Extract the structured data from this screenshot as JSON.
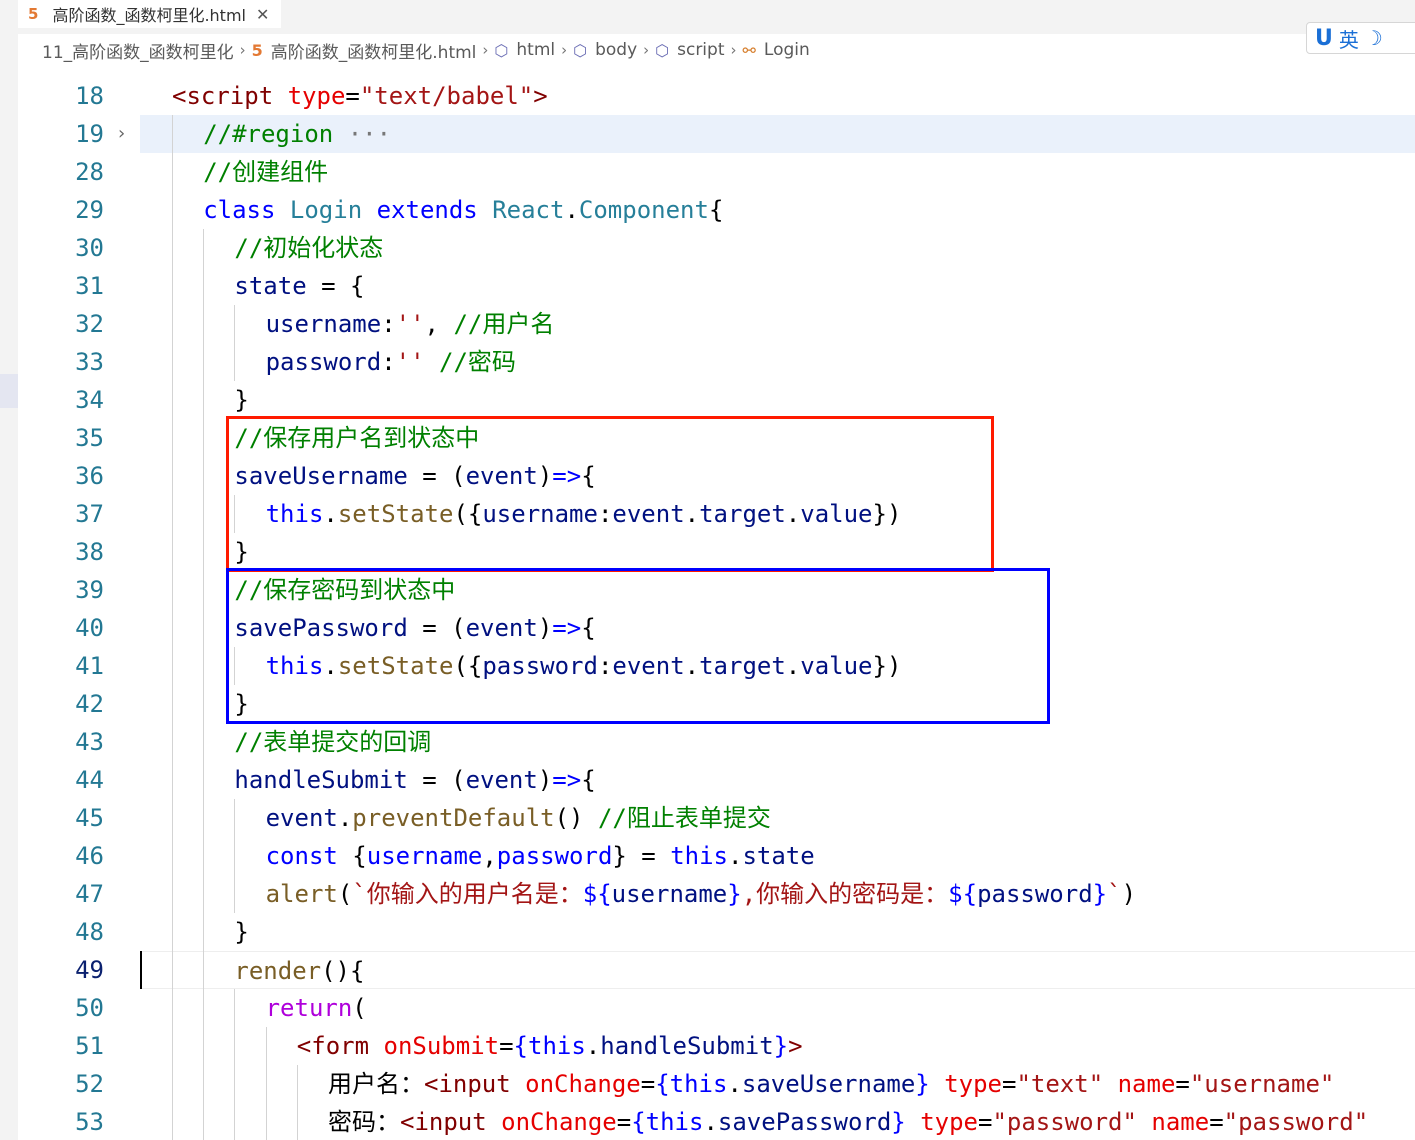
{
  "tab": {
    "title": "高阶函数_函数柯里化.html",
    "icon": "html5-icon"
  },
  "breadcrumb": [
    {
      "label": "11_高阶函数_函数柯里化",
      "icon": ""
    },
    {
      "label": "高阶函数_函数柯里化.html",
      "icon": "html5-icon"
    },
    {
      "label": "html",
      "icon": "cube-icon"
    },
    {
      "label": "body",
      "icon": "cube-icon"
    },
    {
      "label": "script",
      "icon": "cube-icon"
    },
    {
      "label": "Login",
      "icon": "class-icon"
    }
  ],
  "ime": {
    "logo": "U",
    "lang": "英",
    "mode": "☽"
  },
  "editor": {
    "current_line": 49,
    "folded_line": 19,
    "highlighted_line": 19,
    "lines": [
      {
        "n": 18,
        "indent": 1,
        "tokens": [
          [
            "tag",
            "<script "
          ],
          [
            "attr",
            "type"
          ],
          [
            "op",
            "="
          ],
          [
            "str",
            "\"text/babel\""
          ],
          [
            "tag",
            ">"
          ]
        ]
      },
      {
        "n": 19,
        "indent": 2,
        "tokens": [
          [
            "com",
            "//#region "
          ],
          [
            "dim",
            "···"
          ]
        ]
      },
      {
        "n": 28,
        "indent": 2,
        "tokens": [
          [
            "com",
            "//创建组件"
          ]
        ]
      },
      {
        "n": 29,
        "indent": 2,
        "tokens": [
          [
            "kw",
            "class "
          ],
          [
            "cls",
            "Login "
          ],
          [
            "kw",
            "extends "
          ],
          [
            "cls",
            "React"
          ],
          [
            "op",
            "."
          ],
          [
            "cls",
            "Component"
          ],
          [
            "op",
            "{"
          ]
        ]
      },
      {
        "n": 30,
        "indent": 3,
        "tokens": [
          [
            "com",
            "//初始化状态"
          ]
        ]
      },
      {
        "n": 31,
        "indent": 3,
        "tokens": [
          [
            "var",
            "state"
          ],
          [
            "op",
            " = {"
          ]
        ]
      },
      {
        "n": 32,
        "indent": 4,
        "tokens": [
          [
            "var",
            "username"
          ],
          [
            "op",
            ":"
          ],
          [
            "str",
            "''"
          ],
          [
            "op",
            ", "
          ],
          [
            "com",
            "//用户名"
          ]
        ]
      },
      {
        "n": 33,
        "indent": 4,
        "tokens": [
          [
            "var",
            "password"
          ],
          [
            "op",
            ":"
          ],
          [
            "str",
            "''"
          ],
          [
            "op",
            " "
          ],
          [
            "com",
            "//密码"
          ]
        ]
      },
      {
        "n": 34,
        "indent": 3,
        "tokens": [
          [
            "op",
            "}"
          ]
        ]
      },
      {
        "n": 35,
        "indent": 3,
        "tokens": [
          [
            "com",
            "//保存用户名到状态中"
          ]
        ]
      },
      {
        "n": 36,
        "indent": 3,
        "tokens": [
          [
            "var",
            "saveUsername"
          ],
          [
            "op",
            " = ("
          ],
          [
            "var",
            "event"
          ],
          [
            "op",
            ")"
          ],
          [
            "kw",
            "=>"
          ],
          [
            "op",
            "{"
          ]
        ]
      },
      {
        "n": 37,
        "indent": 4,
        "tokens": [
          [
            "kw",
            "this"
          ],
          [
            "op",
            "."
          ],
          [
            "fn",
            "setState"
          ],
          [
            "op",
            "({"
          ],
          [
            "var",
            "username"
          ],
          [
            "op",
            ":"
          ],
          [
            "var",
            "event"
          ],
          [
            "op",
            "."
          ],
          [
            "var",
            "target"
          ],
          [
            "op",
            "."
          ],
          [
            "var",
            "value"
          ],
          [
            "op",
            "})"
          ]
        ]
      },
      {
        "n": 38,
        "indent": 3,
        "tokens": [
          [
            "op",
            "}"
          ]
        ]
      },
      {
        "n": 39,
        "indent": 3,
        "tokens": [
          [
            "com",
            "//保存密码到状态中"
          ]
        ]
      },
      {
        "n": 40,
        "indent": 3,
        "tokens": [
          [
            "var",
            "savePassword"
          ],
          [
            "op",
            " = ("
          ],
          [
            "var",
            "event"
          ],
          [
            "op",
            ")"
          ],
          [
            "kw",
            "=>"
          ],
          [
            "op",
            "{"
          ]
        ]
      },
      {
        "n": 41,
        "indent": 4,
        "tokens": [
          [
            "kw",
            "this"
          ],
          [
            "op",
            "."
          ],
          [
            "fn",
            "setState"
          ],
          [
            "op",
            "({"
          ],
          [
            "var",
            "password"
          ],
          [
            "op",
            ":"
          ],
          [
            "var",
            "event"
          ],
          [
            "op",
            "."
          ],
          [
            "var",
            "target"
          ],
          [
            "op",
            "."
          ],
          [
            "var",
            "value"
          ],
          [
            "op",
            "})"
          ]
        ]
      },
      {
        "n": 42,
        "indent": 3,
        "tokens": [
          [
            "op",
            "}"
          ]
        ]
      },
      {
        "n": 43,
        "indent": 3,
        "tokens": [
          [
            "com",
            "//表单提交的回调"
          ]
        ]
      },
      {
        "n": 44,
        "indent": 3,
        "tokens": [
          [
            "var",
            "handleSubmit"
          ],
          [
            "op",
            " = ("
          ],
          [
            "var",
            "event"
          ],
          [
            "op",
            ")"
          ],
          [
            "kw",
            "=>"
          ],
          [
            "op",
            "{"
          ]
        ]
      },
      {
        "n": 45,
        "indent": 4,
        "tokens": [
          [
            "var",
            "event"
          ],
          [
            "op",
            "."
          ],
          [
            "fn",
            "preventDefault"
          ],
          [
            "op",
            "() "
          ],
          [
            "com",
            "//阻止表单提交"
          ]
        ]
      },
      {
        "n": 46,
        "indent": 4,
        "tokens": [
          [
            "kw",
            "const "
          ],
          [
            "op",
            "{"
          ],
          [
            "kw",
            "username"
          ],
          [
            "op",
            ","
          ],
          [
            "kw",
            "password"
          ],
          [
            "op",
            "} = "
          ],
          [
            "kw",
            "this"
          ],
          [
            "op",
            "."
          ],
          [
            "var",
            "state"
          ]
        ]
      },
      {
        "n": 47,
        "indent": 4,
        "tokens": [
          [
            "fn",
            "alert"
          ],
          [
            "op",
            "("
          ],
          [
            "str",
            "`你输入的用户名是："
          ],
          [
            "kw",
            "${"
          ],
          [
            "var",
            "username"
          ],
          [
            "kw",
            "}"
          ],
          [
            "str",
            ",你输入的密码是："
          ],
          [
            "kw",
            "${"
          ],
          [
            "var",
            "password"
          ],
          [
            "kw",
            "}"
          ],
          [
            "str",
            "`"
          ],
          [
            "op",
            ")"
          ]
        ]
      },
      {
        "n": 48,
        "indent": 3,
        "tokens": [
          [
            "op",
            "}"
          ]
        ]
      },
      {
        "n": 49,
        "indent": 3,
        "tokens": [
          [
            "fn",
            "render"
          ],
          [
            "op",
            "(){"
          ]
        ]
      },
      {
        "n": 50,
        "indent": 4,
        "tokens": [
          [
            "ctl",
            "return"
          ],
          [
            "op",
            "("
          ]
        ]
      },
      {
        "n": 51,
        "indent": 5,
        "tokens": [
          [
            "tag",
            "<form "
          ],
          [
            "attr",
            "onSubmit"
          ],
          [
            "op",
            "="
          ],
          [
            "kw",
            "{this"
          ],
          [
            "op",
            "."
          ],
          [
            "var",
            "handleSubmit"
          ],
          [
            "kw",
            "}"
          ],
          [
            "tag",
            ">"
          ]
        ]
      },
      {
        "n": 52,
        "indent": 6,
        "tokens": [
          [
            "op",
            "用户名："
          ],
          [
            "tag",
            "<input "
          ],
          [
            "attr",
            "onChange"
          ],
          [
            "op",
            "="
          ],
          [
            "kw",
            "{this"
          ],
          [
            "op",
            "."
          ],
          [
            "var",
            "saveUsername"
          ],
          [
            "kw",
            "} "
          ],
          [
            "attr",
            "type"
          ],
          [
            "op",
            "="
          ],
          [
            "str",
            "\"text\" "
          ],
          [
            "attr",
            "name"
          ],
          [
            "op",
            "="
          ],
          [
            "str",
            "\"username\""
          ]
        ]
      },
      {
        "n": 53,
        "indent": 6,
        "tokens": [
          [
            "op",
            "密码："
          ],
          [
            "tag",
            "<input "
          ],
          [
            "attr",
            "onChange"
          ],
          [
            "op",
            "="
          ],
          [
            "kw",
            "{this"
          ],
          [
            "op",
            "."
          ],
          [
            "var",
            "savePassword"
          ],
          [
            "kw",
            "} "
          ],
          [
            "attr",
            "type"
          ],
          [
            "op",
            "="
          ],
          [
            "str",
            "\"password\" "
          ],
          [
            "attr",
            "name"
          ],
          [
            "op",
            "="
          ],
          [
            "str",
            "\"password\""
          ]
        ]
      }
    ]
  },
  "annotations": [
    {
      "color": "#ff1a00",
      "from_line": 35,
      "to_line": 38,
      "label": "saveUsername block"
    },
    {
      "color": "#0000ff",
      "from_line": 39,
      "to_line": 42,
      "label": "savePassword block"
    }
  ]
}
